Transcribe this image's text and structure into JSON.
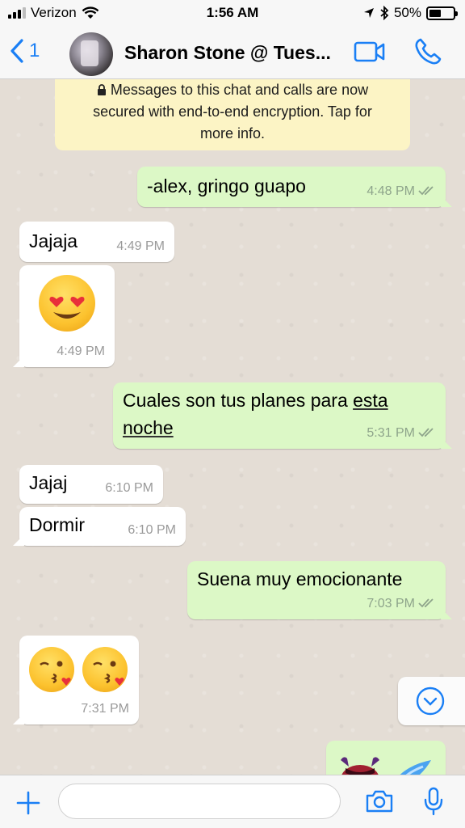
{
  "status_bar": {
    "carrier": "Verizon",
    "time": "1:56 AM",
    "battery_percent": "50%",
    "battery_level": 0.5
  },
  "header": {
    "back_count": "1",
    "title": "Sharon Stone @ Tues..."
  },
  "encryption_notice": {
    "line1": "Messages to this chat and calls are now",
    "line2": "secured with end-to-end encryption. Tap for",
    "line3": "more info."
  },
  "messages": [
    {
      "direction": "out",
      "text": "-alex, gringo guapo",
      "time": "4:48 PM",
      "read": true
    },
    {
      "direction": "in",
      "text": "Jajaja",
      "time": "4:49 PM"
    },
    {
      "direction": "in",
      "text": "😍",
      "time": "4:49 PM",
      "kind": "emoji",
      "emoji_name": "heart-eyes"
    },
    {
      "direction": "out",
      "text_line1_a": "Cuales son tus planes para ",
      "text_line1_b": "esta",
      "text_line2": "noche",
      "time": "5:31 PM",
      "read": true
    },
    {
      "direction": "in",
      "text": "Jajaj",
      "time": "6:10 PM"
    },
    {
      "direction": "in",
      "text": "Dormir",
      "time": "6:10 PM"
    },
    {
      "direction": "out",
      "text": "Suena muy emocionante",
      "time": "7:03 PM",
      "read": true
    },
    {
      "direction": "in",
      "text": "😘 😘",
      "time": "7:31 PM",
      "kind": "emoji",
      "emoji_name": "kissing-heart"
    }
  ],
  "colors": {
    "accent": "#1a7ff5",
    "outgoing_bubble": "#dcf8c6",
    "incoming_bubble": "#ffffff",
    "notice": "#fcf4c5",
    "chat_bg": "#e4ddd5",
    "read_ticks": "#8ea48b"
  },
  "input": {
    "value": "",
    "placeholder": ""
  },
  "icons": [
    "back-chevron-icon",
    "video-call-icon",
    "phone-icon",
    "lock-icon",
    "scroll-down-icon",
    "plus-icon",
    "camera-icon",
    "microphone-icon"
  ]
}
